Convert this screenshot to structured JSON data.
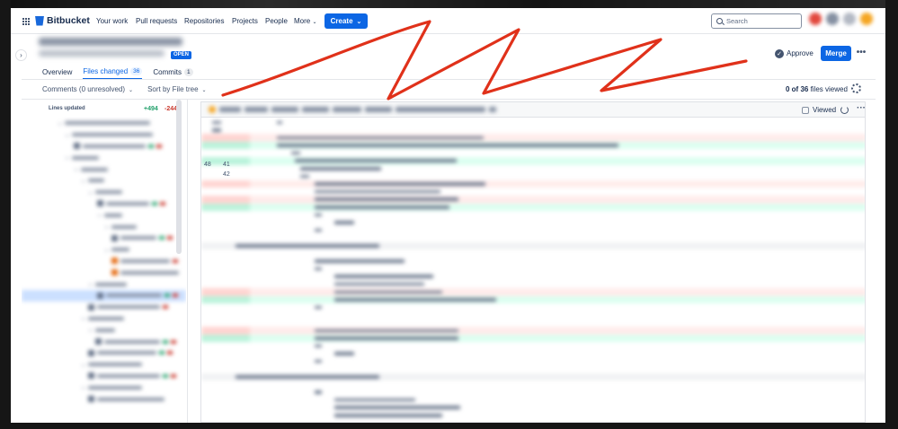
{
  "topnav": {
    "logo": "Bitbucket",
    "items": [
      "Your work",
      "Pull requests",
      "Repositories",
      "Projects",
      "People",
      "More"
    ],
    "create_label": "Create",
    "search_placeholder": "Search"
  },
  "header": {
    "status_badge": "OPEN",
    "approve_label": "Approve",
    "merge_label": "Merge",
    "more_label": "•••"
  },
  "tabs": [
    {
      "label": "Overview",
      "count": ""
    },
    {
      "label": "Files changed",
      "count": "36"
    },
    {
      "label": "Commits",
      "count": "1"
    }
  ],
  "filters": {
    "comments": "Comments (0 unresolved)",
    "sort": "Sort by File tree",
    "files_viewed_count": "0 of 36",
    "files_viewed_suffix": "files viewed"
  },
  "tree": {
    "lines_updated": "Lines updated",
    "additions": "+494",
    "deletions": "-244"
  },
  "diff": {
    "viewed_label": "Viewed",
    "visible_line_numbers": {
      "a": "48",
      "b": "41",
      "c": "42"
    }
  },
  "colors": {
    "brand": "#0c66e4",
    "annotation_stroke": "#e0311a",
    "addition": "#22a06b",
    "deletion": "#c9372c"
  }
}
